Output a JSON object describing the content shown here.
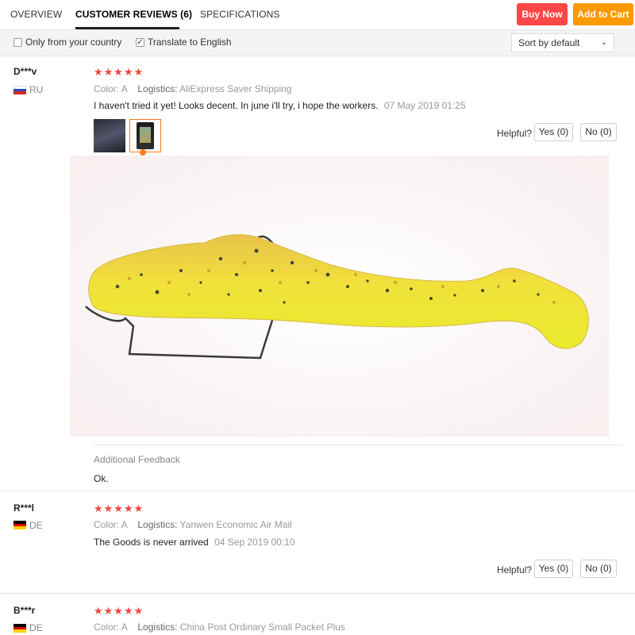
{
  "tabs": [
    {
      "label": "OVERVIEW"
    },
    {
      "label": "CUSTOMER REVIEWS (6)"
    },
    {
      "label": "SPECIFICATIONS"
    }
  ],
  "actions": {
    "buy_now": "Buy Now",
    "add_to_cart": "Add to Cart"
  },
  "filters": {
    "only_country": {
      "label": "Only from your country",
      "checked": false,
      "mark": ""
    },
    "translate": {
      "label": "Translate to English",
      "checked": true,
      "mark": "✓"
    },
    "sort": {
      "value": "Sort by default",
      "caret": "⌄"
    }
  },
  "labels": {
    "color": "Color:",
    "logistics": "Logistics:",
    "helpful": "Helpful?",
    "additional_feedback": "Additional Feedback",
    "stars": "★★★★★"
  },
  "reviews": [
    {
      "user": "D***v",
      "country": "RU",
      "rating": 5,
      "color": "A",
      "logistics": "AliExpress Saver Shipping",
      "text": "I haven't tried it yet! Looks decent. In june i'll try, i hope the workers.",
      "date": "07 May 2019 01:25",
      "yes": "Yes (0)",
      "no": "No (0)",
      "additional_feedback": "Ok.",
      "flag_colors": [
        "#ffffff",
        "#2b4bb3",
        "#d52b1e"
      ]
    },
    {
      "user": "R***l",
      "country": "DE",
      "rating": 5,
      "color": "A",
      "logistics": "Yanwen Economic Air Mail",
      "text": "The Goods is never arrived",
      "date": "04 Sep 2019 00:10",
      "yes": "Yes (0)",
      "no": "No (0)",
      "flag_colors": [
        "#000000",
        "#dd0000",
        "#ffce00"
      ]
    },
    {
      "user": "B***r",
      "country": "DE",
      "rating": 5,
      "color": "A",
      "logistics": "China Post Ordinary Small Packet Plus",
      "flag_colors": [
        "#000000",
        "#dd0000",
        "#ffce00"
      ]
    }
  ],
  "colors": {
    "buy_now": "#ff4747",
    "add_to_cart": "#ff9900",
    "stars": "#f1463c",
    "accent": "#ff7a1a"
  }
}
